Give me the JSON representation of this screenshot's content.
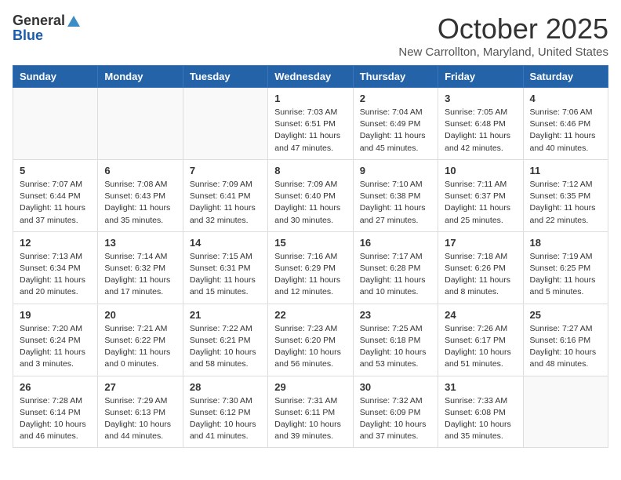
{
  "header": {
    "logo_general": "General",
    "logo_blue": "Blue",
    "title": "October 2025",
    "subtitle": "New Carrollton, Maryland, United States"
  },
  "days_of_week": [
    "Sunday",
    "Monday",
    "Tuesday",
    "Wednesday",
    "Thursday",
    "Friday",
    "Saturday"
  ],
  "weeks": [
    [
      {
        "day": "",
        "info": ""
      },
      {
        "day": "",
        "info": ""
      },
      {
        "day": "",
        "info": ""
      },
      {
        "day": "1",
        "info": "Sunrise: 7:03 AM\nSunset: 6:51 PM\nDaylight: 11 hours\nand 47 minutes."
      },
      {
        "day": "2",
        "info": "Sunrise: 7:04 AM\nSunset: 6:49 PM\nDaylight: 11 hours\nand 45 minutes."
      },
      {
        "day": "3",
        "info": "Sunrise: 7:05 AM\nSunset: 6:48 PM\nDaylight: 11 hours\nand 42 minutes."
      },
      {
        "day": "4",
        "info": "Sunrise: 7:06 AM\nSunset: 6:46 PM\nDaylight: 11 hours\nand 40 minutes."
      }
    ],
    [
      {
        "day": "5",
        "info": "Sunrise: 7:07 AM\nSunset: 6:44 PM\nDaylight: 11 hours\nand 37 minutes."
      },
      {
        "day": "6",
        "info": "Sunrise: 7:08 AM\nSunset: 6:43 PM\nDaylight: 11 hours\nand 35 minutes."
      },
      {
        "day": "7",
        "info": "Sunrise: 7:09 AM\nSunset: 6:41 PM\nDaylight: 11 hours\nand 32 minutes."
      },
      {
        "day": "8",
        "info": "Sunrise: 7:09 AM\nSunset: 6:40 PM\nDaylight: 11 hours\nand 30 minutes."
      },
      {
        "day": "9",
        "info": "Sunrise: 7:10 AM\nSunset: 6:38 PM\nDaylight: 11 hours\nand 27 minutes."
      },
      {
        "day": "10",
        "info": "Sunrise: 7:11 AM\nSunset: 6:37 PM\nDaylight: 11 hours\nand 25 minutes."
      },
      {
        "day": "11",
        "info": "Sunrise: 7:12 AM\nSunset: 6:35 PM\nDaylight: 11 hours\nand 22 minutes."
      }
    ],
    [
      {
        "day": "12",
        "info": "Sunrise: 7:13 AM\nSunset: 6:34 PM\nDaylight: 11 hours\nand 20 minutes."
      },
      {
        "day": "13",
        "info": "Sunrise: 7:14 AM\nSunset: 6:32 PM\nDaylight: 11 hours\nand 17 minutes."
      },
      {
        "day": "14",
        "info": "Sunrise: 7:15 AM\nSunset: 6:31 PM\nDaylight: 11 hours\nand 15 minutes."
      },
      {
        "day": "15",
        "info": "Sunrise: 7:16 AM\nSunset: 6:29 PM\nDaylight: 11 hours\nand 12 minutes."
      },
      {
        "day": "16",
        "info": "Sunrise: 7:17 AM\nSunset: 6:28 PM\nDaylight: 11 hours\nand 10 minutes."
      },
      {
        "day": "17",
        "info": "Sunrise: 7:18 AM\nSunset: 6:26 PM\nDaylight: 11 hours\nand 8 minutes."
      },
      {
        "day": "18",
        "info": "Sunrise: 7:19 AM\nSunset: 6:25 PM\nDaylight: 11 hours\nand 5 minutes."
      }
    ],
    [
      {
        "day": "19",
        "info": "Sunrise: 7:20 AM\nSunset: 6:24 PM\nDaylight: 11 hours\nand 3 minutes."
      },
      {
        "day": "20",
        "info": "Sunrise: 7:21 AM\nSunset: 6:22 PM\nDaylight: 11 hours\nand 0 minutes."
      },
      {
        "day": "21",
        "info": "Sunrise: 7:22 AM\nSunset: 6:21 PM\nDaylight: 10 hours\nand 58 minutes."
      },
      {
        "day": "22",
        "info": "Sunrise: 7:23 AM\nSunset: 6:20 PM\nDaylight: 10 hours\nand 56 minutes."
      },
      {
        "day": "23",
        "info": "Sunrise: 7:25 AM\nSunset: 6:18 PM\nDaylight: 10 hours\nand 53 minutes."
      },
      {
        "day": "24",
        "info": "Sunrise: 7:26 AM\nSunset: 6:17 PM\nDaylight: 10 hours\nand 51 minutes."
      },
      {
        "day": "25",
        "info": "Sunrise: 7:27 AM\nSunset: 6:16 PM\nDaylight: 10 hours\nand 48 minutes."
      }
    ],
    [
      {
        "day": "26",
        "info": "Sunrise: 7:28 AM\nSunset: 6:14 PM\nDaylight: 10 hours\nand 46 minutes."
      },
      {
        "day": "27",
        "info": "Sunrise: 7:29 AM\nSunset: 6:13 PM\nDaylight: 10 hours\nand 44 minutes."
      },
      {
        "day": "28",
        "info": "Sunrise: 7:30 AM\nSunset: 6:12 PM\nDaylight: 10 hours\nand 41 minutes."
      },
      {
        "day": "29",
        "info": "Sunrise: 7:31 AM\nSunset: 6:11 PM\nDaylight: 10 hours\nand 39 minutes."
      },
      {
        "day": "30",
        "info": "Sunrise: 7:32 AM\nSunset: 6:09 PM\nDaylight: 10 hours\nand 37 minutes."
      },
      {
        "day": "31",
        "info": "Sunrise: 7:33 AM\nSunset: 6:08 PM\nDaylight: 10 hours\nand 35 minutes."
      },
      {
        "day": "",
        "info": ""
      }
    ]
  ]
}
